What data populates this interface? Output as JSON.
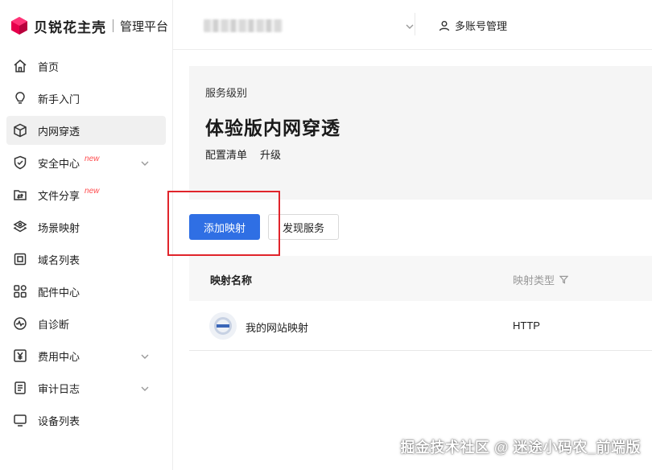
{
  "brand": {
    "name": "贝锐花主壳",
    "sub": "管理平台",
    "accent": "#e6004c"
  },
  "header": {
    "multi_account": "多账号管理",
    "multi_account_icon": "user-icon",
    "account_select_chevron": "chevron-down-icon"
  },
  "sidebar": {
    "items": [
      {
        "label": "首页",
        "icon": "home-icon",
        "active": false,
        "badge": "",
        "has_chevron": false
      },
      {
        "label": "新手入门",
        "icon": "lightbulb-icon",
        "active": false,
        "badge": "",
        "has_chevron": false
      },
      {
        "label": "内网穿透",
        "icon": "cube-icon",
        "active": true,
        "badge": "",
        "has_chevron": false
      },
      {
        "label": "安全中心",
        "icon": "shield-icon",
        "active": false,
        "badge": "new",
        "has_chevron": true
      },
      {
        "label": "文件分享",
        "icon": "folder-share-icon",
        "active": false,
        "badge": "new",
        "has_chevron": false
      },
      {
        "label": "场景映射",
        "icon": "layers-icon",
        "active": false,
        "badge": "",
        "has_chevron": false
      },
      {
        "label": "域名列表",
        "icon": "domain-icon",
        "active": false,
        "badge": "",
        "has_chevron": false
      },
      {
        "label": "配件中心",
        "icon": "grid-icon",
        "active": false,
        "badge": "",
        "has_chevron": false
      },
      {
        "label": "自诊断",
        "icon": "diagnosis-icon",
        "active": false,
        "badge": "",
        "has_chevron": false
      },
      {
        "label": "费用中心",
        "icon": "yen-icon",
        "active": false,
        "badge": "",
        "has_chevron": true
      },
      {
        "label": "审计日志",
        "icon": "log-icon",
        "active": false,
        "badge": "",
        "has_chevron": true
      },
      {
        "label": "设备列表",
        "icon": "monitor-icon",
        "active": false,
        "badge": "",
        "has_chevron": false
      }
    ]
  },
  "service": {
    "level_label": "服务级别",
    "title": "体验版内网穿透",
    "links": [
      "配置清单",
      "升级"
    ]
  },
  "actions": {
    "add_mapping": "添加映射",
    "discover_service": "发现服务",
    "primary_color": "#2f6fe4",
    "highlight_color": "#e0242b"
  },
  "table": {
    "headers": {
      "name": "映射名称",
      "type": "映射类型"
    },
    "rows": [
      {
        "name": "我的网站映射",
        "type": "HTTP",
        "icon": "browser-icon"
      }
    ]
  },
  "watermark": "掘金技术社区 @ 迷途小码农_前端版"
}
